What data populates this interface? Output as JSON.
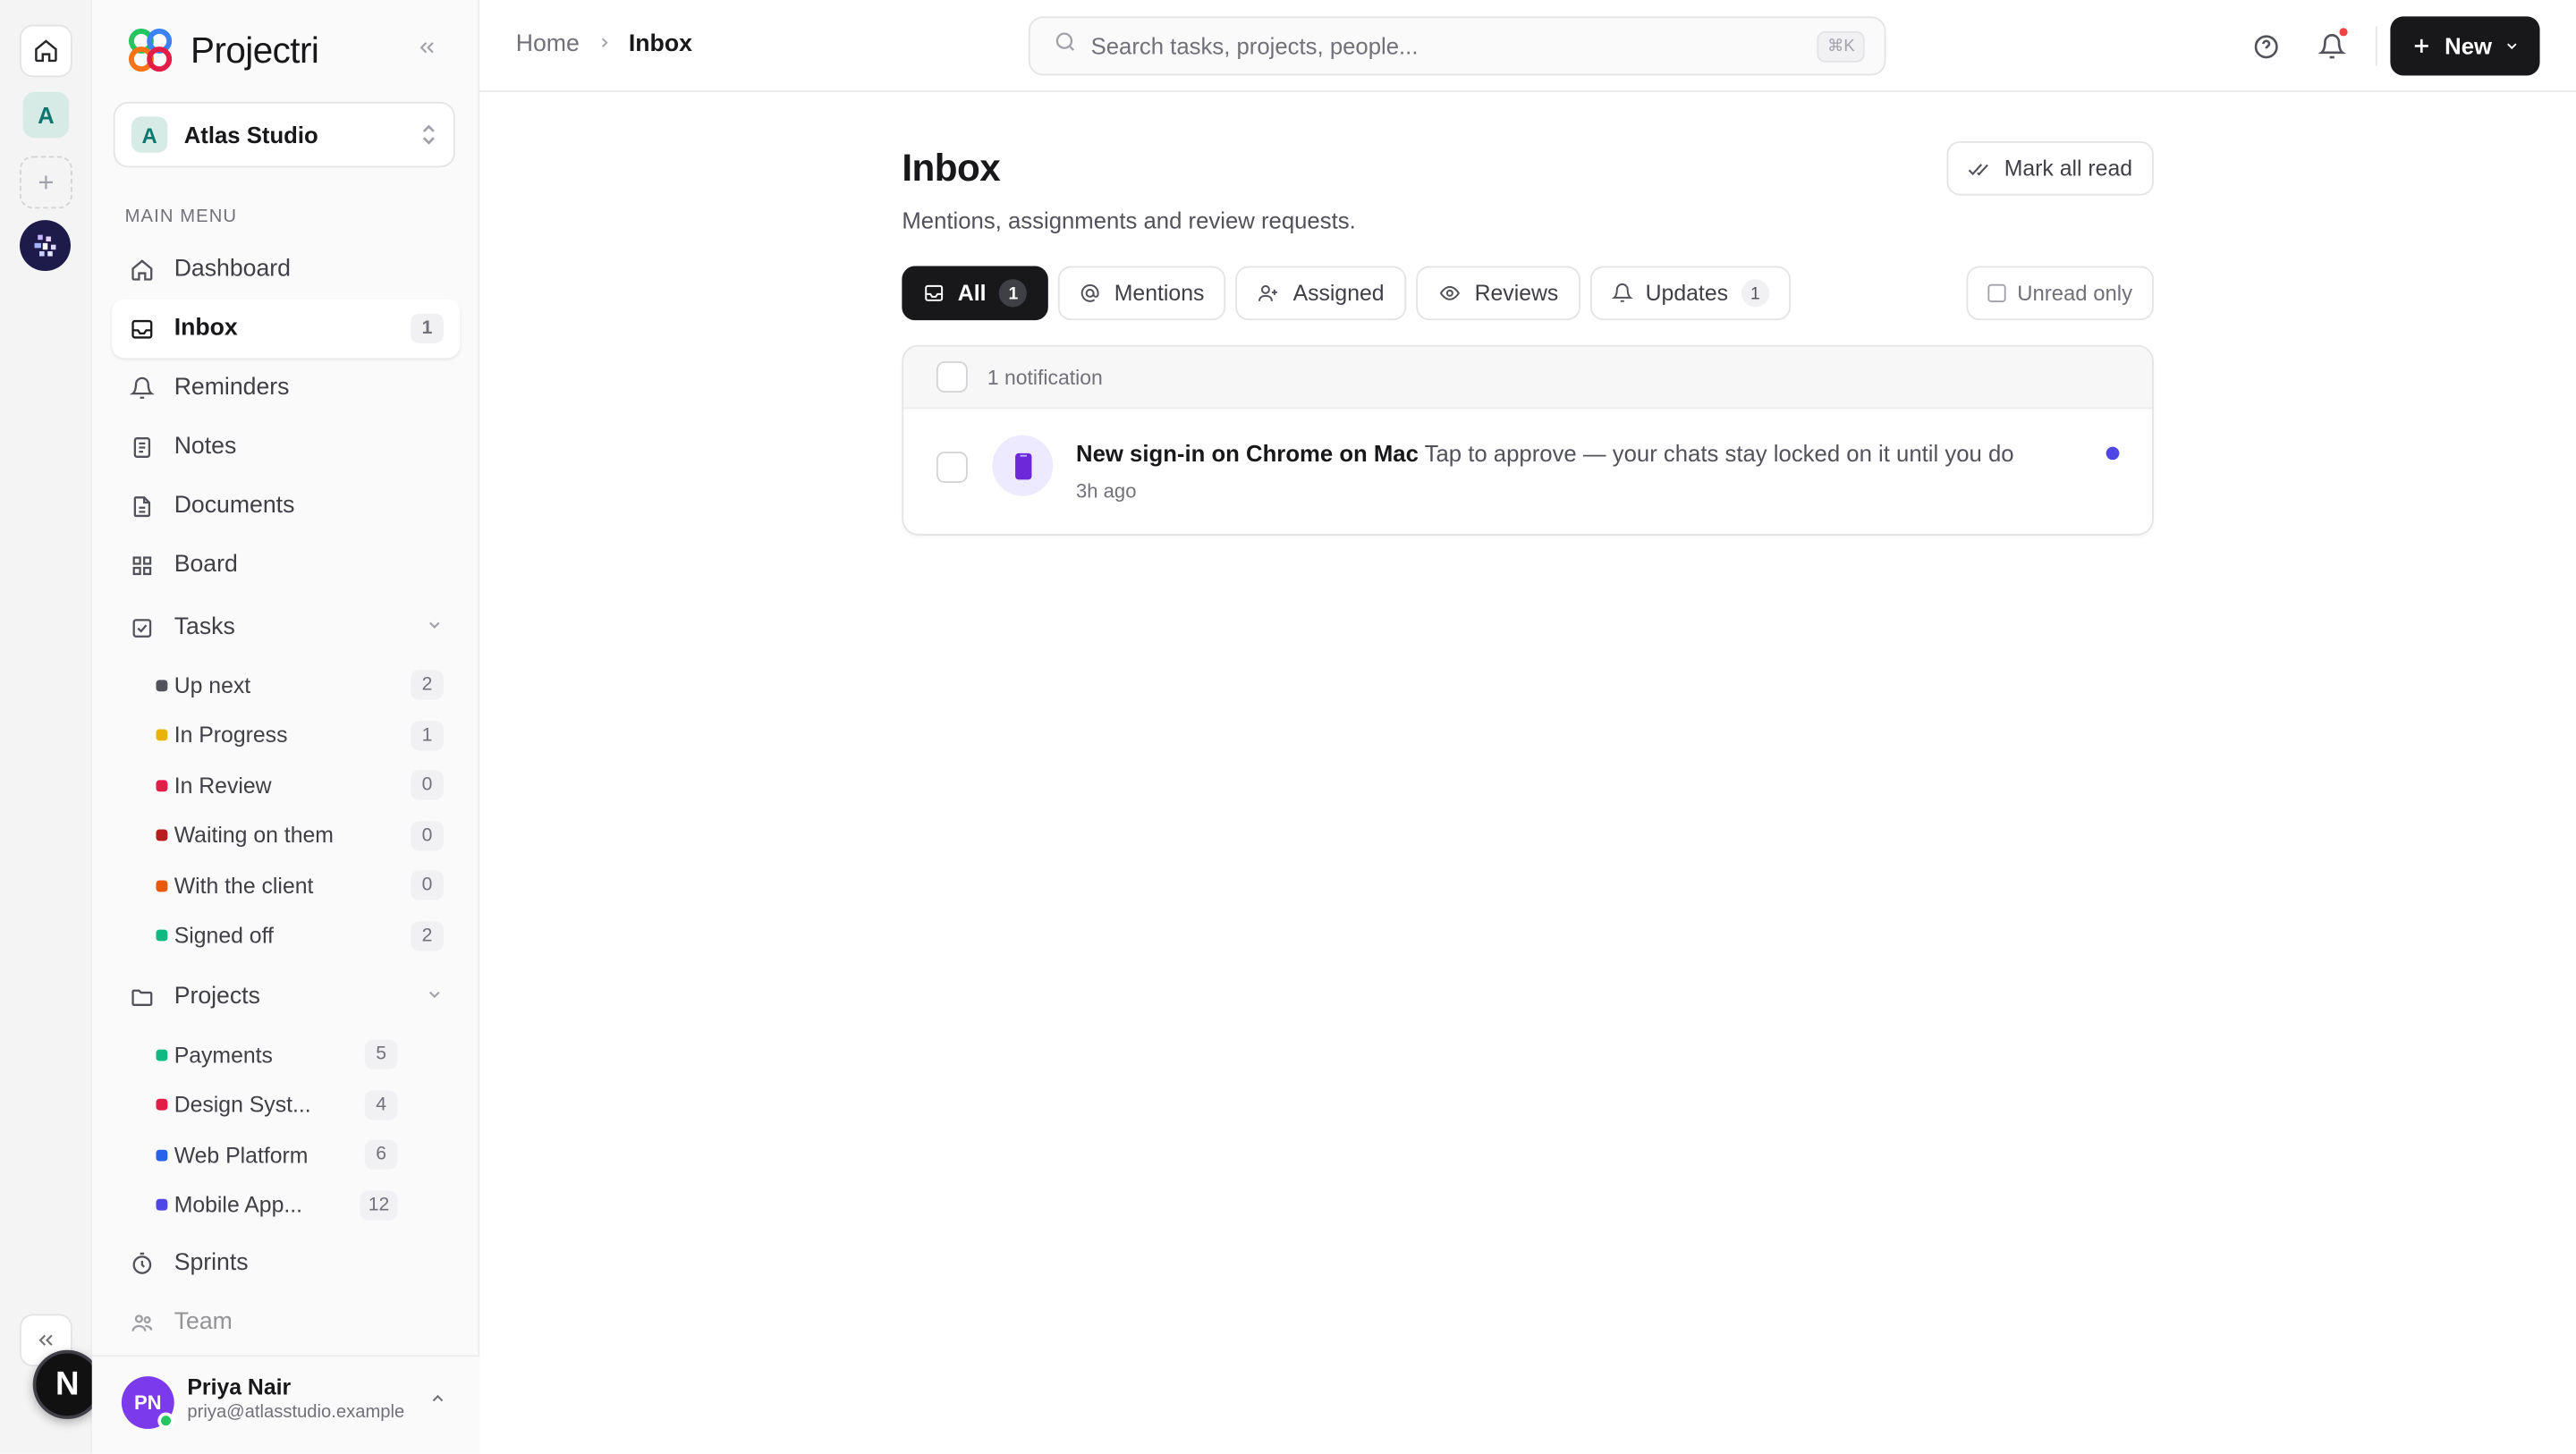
{
  "app": {
    "name": "Projectri"
  },
  "workspace": {
    "name": "Atlas Studio",
    "initial": "A"
  },
  "rail": {
    "workspace_initial": "A",
    "bottom_badge": "N"
  },
  "sidebar": {
    "section_label": "MAIN MENU",
    "items": [
      {
        "label": "Dashboard",
        "icon": "home-icon"
      },
      {
        "label": "Inbox",
        "icon": "inbox-icon",
        "count": "1",
        "active": true
      },
      {
        "label": "Reminders",
        "icon": "bell-icon"
      },
      {
        "label": "Notes",
        "icon": "notes-icon"
      },
      {
        "label": "Documents",
        "icon": "document-icon"
      },
      {
        "label": "Board",
        "icon": "grid-icon"
      }
    ],
    "tasks": {
      "label": "Tasks",
      "items": [
        {
          "label": "Up next",
          "count": "2",
          "color": "#52525b"
        },
        {
          "label": "In Progress",
          "count": "1",
          "color": "#eab308"
        },
        {
          "label": "In Review",
          "count": "0",
          "color": "#e11d48"
        },
        {
          "label": "Waiting on them",
          "count": "0",
          "color": "#b91c1c"
        },
        {
          "label": "With the client",
          "count": "0",
          "color": "#ea580c"
        },
        {
          "label": "Signed off",
          "count": "2",
          "color": "#10b981"
        }
      ]
    },
    "projects": {
      "label": "Projects",
      "items": [
        {
          "label": "Payments",
          "count": "5",
          "color": "#10b981"
        },
        {
          "label": "Design Syst...",
          "count": "4",
          "color": "#e11d48"
        },
        {
          "label": "Web Platform",
          "count": "6",
          "color": "#2563eb"
        },
        {
          "label": "Mobile App...",
          "count": "12",
          "color": "#4f46e5"
        }
      ]
    },
    "sprints_label": "Sprints",
    "team_label": "Team"
  },
  "user": {
    "initials": "PN",
    "name": "Priya Nair",
    "email": "priya@atlasstudio.example"
  },
  "topbar": {
    "breadcrumb_home": "Home",
    "breadcrumb_current": "Inbox",
    "search_placeholder": "Search tasks, projects, people...",
    "search_shortcut": "⌘K",
    "new_label": "New"
  },
  "inbox": {
    "title": "Inbox",
    "subtitle": "Mentions, assignments and review requests.",
    "mark_all_read": "Mark all read",
    "tabs": [
      {
        "label": "All",
        "count": "1"
      },
      {
        "label": "Mentions"
      },
      {
        "label": "Assigned"
      },
      {
        "label": "Reviews"
      },
      {
        "label": "Updates",
        "count": "1"
      }
    ],
    "unread_only": "Unread only",
    "list_header": "1 notification",
    "notifications": [
      {
        "title": "New sign-in on Chrome on Mac",
        "message": "Tap to approve — your chats stay locked on it until you do",
        "time": "3h ago",
        "unread": true
      }
    ]
  },
  "colors": {
    "accent": "#4f46e5",
    "primary_button": "#18181b"
  }
}
